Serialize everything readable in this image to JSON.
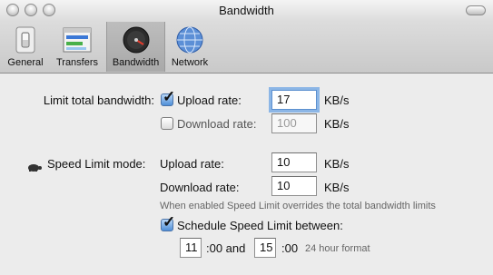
{
  "window": {
    "title": "Bandwidth"
  },
  "toolbar": {
    "items": [
      {
        "label": "General"
      },
      {
        "label": "Transfers"
      },
      {
        "label": "Bandwidth"
      },
      {
        "label": "Network"
      }
    ]
  },
  "limit_total": {
    "label": "Limit total bandwidth:",
    "upload": {
      "label": "Upload rate:",
      "value": "17",
      "unit": "KB/s",
      "checked": true
    },
    "download": {
      "label": "Download rate:",
      "value": "100",
      "unit": "KB/s",
      "checked": false
    }
  },
  "speed_limit": {
    "label": "Speed Limit mode:",
    "upload": {
      "label": "Upload rate:",
      "value": "10",
      "unit": "KB/s"
    },
    "download": {
      "label": "Download rate:",
      "value": "10",
      "unit": "KB/s"
    },
    "hint": "When enabled Speed Limit overrides the total bandwidth limits",
    "schedule": {
      "label": "Schedule Speed Limit between:",
      "checked": true,
      "from_hour": "11",
      "from_suffix": ":00 and",
      "to_hour": "15",
      "to_suffix": ":00",
      "format_note": "24 hour format"
    }
  }
}
